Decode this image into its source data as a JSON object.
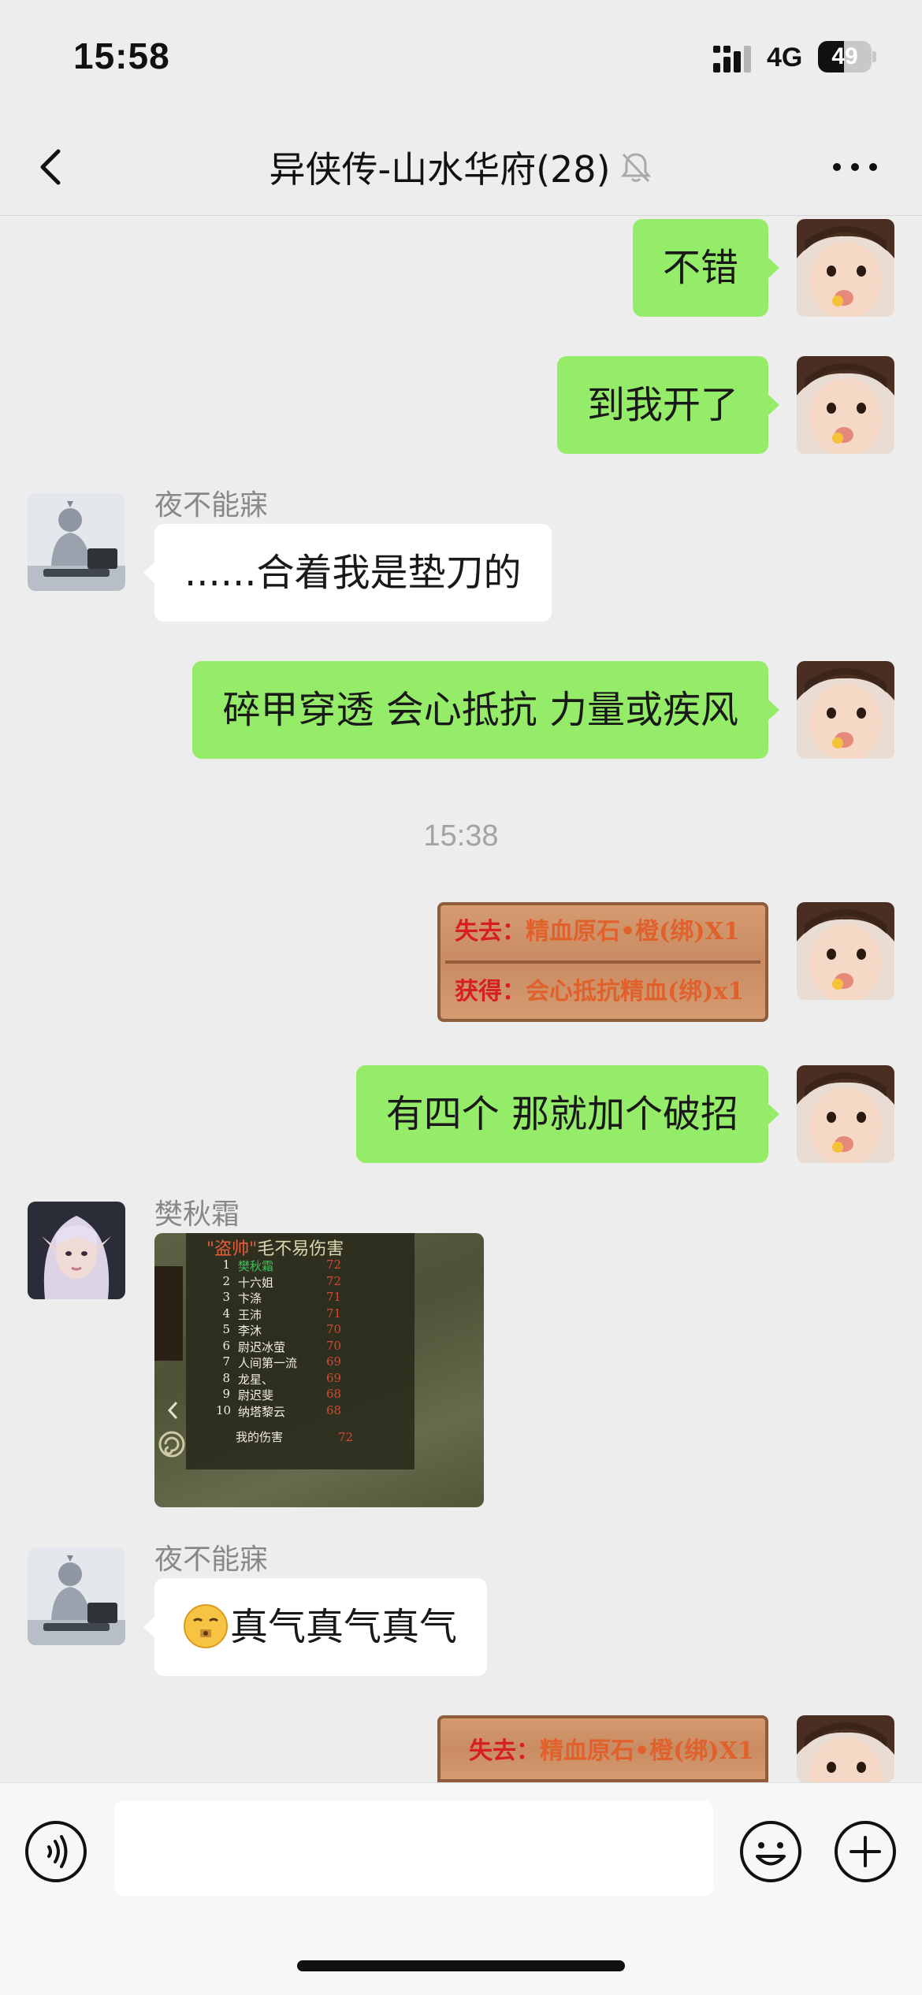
{
  "status_bar": {
    "time": "15:58",
    "network": "4G",
    "battery_text": "49",
    "battery_level_percent": 49
  },
  "nav": {
    "title": "异侠传-山水华府(28)",
    "muted": true
  },
  "messages": [
    {
      "side": "self",
      "type": "text",
      "text": "不错"
    },
    {
      "side": "self",
      "type": "text",
      "text": "到我开了"
    },
    {
      "side": "other",
      "sender": "夜不能寐",
      "type": "text",
      "text": "......合着我是垫刀的"
    },
    {
      "side": "self",
      "type": "text",
      "text": "碎甲穿透 会心抵抗 力量或疾风"
    },
    {
      "type": "time",
      "text": "15:38"
    },
    {
      "side": "self",
      "type": "image",
      "lines": [
        {
          "key": "失去：",
          "value": "精血原石•橙(绑)X1"
        },
        {
          "key": "获得：",
          "value": "会心抵抗精血(绑)x1"
        }
      ]
    },
    {
      "side": "self",
      "type": "text",
      "text": "有四个 那就加个破招"
    },
    {
      "side": "other",
      "sender": "樊秋霜",
      "type": "image",
      "ranking": {
        "title_highlight": "\"盗帅\"",
        "title_rest": "毛不易伤害",
        "rows": [
          {
            "no": "1",
            "name": "樊秋霜",
            "value": "72"
          },
          {
            "no": "2",
            "name": "十六姐",
            "value": "72"
          },
          {
            "no": "3",
            "name": "卞涤",
            "value": "71"
          },
          {
            "no": "4",
            "name": "王沛",
            "value": "71"
          },
          {
            "no": "5",
            "name": "李沐",
            "value": "70"
          },
          {
            "no": "6",
            "name": "尉迟冰萤",
            "value": "70"
          },
          {
            "no": "7",
            "name": "人间第一流",
            "value": "69"
          },
          {
            "no": "8",
            "name": "龙星、",
            "value": "69"
          },
          {
            "no": "9",
            "name": "尉迟斐",
            "value": "68"
          },
          {
            "no": "10",
            "name": "纳塔黎云",
            "value": "68"
          }
        ],
        "mine_label": "我的伤害",
        "mine_value": "72"
      }
    },
    {
      "side": "other",
      "sender": "夜不能寐",
      "type": "text",
      "emoji": "sealed-mouth-emoji",
      "text": "真气真气真气"
    },
    {
      "side": "self",
      "type": "image",
      "lines": [
        {
          "key": "失去：",
          "value": "精血原石•橙(绑)X1"
        }
      ]
    }
  ],
  "input_bar": {
    "value": "",
    "icons": [
      "voice-icon",
      "emoji-icon",
      "plus-icon"
    ]
  },
  "colors": {
    "self_bubble": "#95ec69",
    "other_bubble": "#ffffff",
    "background": "#ededed"
  }
}
